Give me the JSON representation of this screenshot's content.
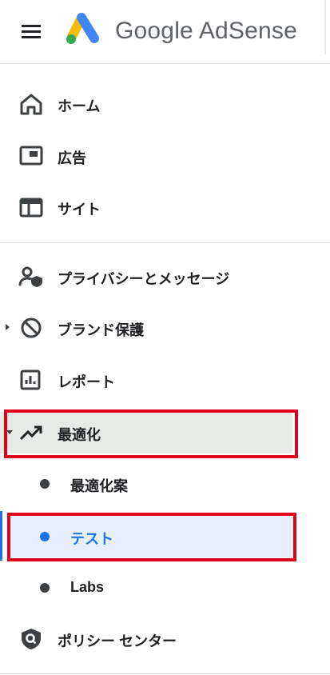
{
  "header": {
    "brand_text": "Google AdSense",
    "logo_colors": {
      "yellow": "#fbbc04",
      "green": "#34a853",
      "blue": "#4285f4"
    }
  },
  "nav": {
    "items": [
      {
        "label": "ホーム",
        "icon": "home-icon"
      },
      {
        "label": "広告",
        "icon": "ads-icon"
      },
      {
        "label": "サイト",
        "icon": "sites-icon"
      },
      {
        "label": "プライバシーとメッセージ",
        "icon": "privacy-messaging-icon"
      },
      {
        "label": "ブランド保護",
        "icon": "brand-safety-icon"
      },
      {
        "label": "レポート",
        "icon": "reports-icon"
      },
      {
        "label": "最適化",
        "icon": "trending-up-icon",
        "expanded": true
      },
      {
        "label": "ポリシー センター",
        "icon": "policy-shield-icon"
      }
    ],
    "optimization_subitems": [
      {
        "label": "最適化案"
      },
      {
        "label": "テスト",
        "selected": true
      },
      {
        "label": "Labs"
      }
    ]
  },
  "colors": {
    "accent": "#1a73e8",
    "selected_bg": "#e8f0fe",
    "highlight_border": "#e0001b",
    "icon": "#3c4043"
  }
}
